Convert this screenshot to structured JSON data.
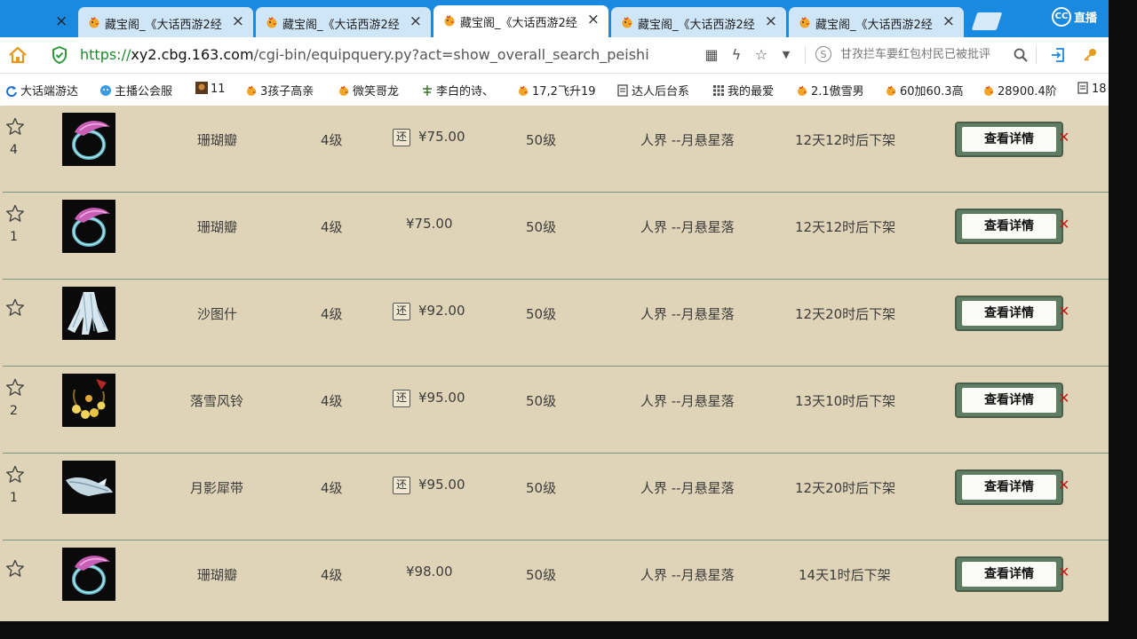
{
  "tabs": [
    {
      "title": "藏宝阁_《大话西游2经",
      "active": false
    },
    {
      "title": "藏宝阁_《大话西游2经",
      "active": false
    },
    {
      "title": "藏宝阁_《大话西游2经",
      "active": true
    },
    {
      "title": "藏宝阁_《大话西游2经",
      "active": false
    },
    {
      "title": "藏宝阁_《大话西游2经",
      "active": false
    }
  ],
  "overlay_logo": {
    "text": "直播",
    "mark": "CC"
  },
  "address": {
    "scheme": "https://",
    "host": "xy2.cbg.163.com",
    "path": "/cgi-bin/equipquery.py?act=show_overall_search_peishi"
  },
  "search": {
    "placeholder": "甘孜拦车要红包村民已被批评"
  },
  "bookmarks": [
    {
      "label": "大话端游达",
      "icon": "sync-icon"
    },
    {
      "label": "主播公会服",
      "icon": "cloud-icon"
    },
    {
      "label": "11",
      "icon": "game-avatar-icon"
    },
    {
      "label": "3孩子高亲",
      "icon": "chick-icon"
    },
    {
      "label": "微笑哥龙",
      "icon": "chick-icon"
    },
    {
      "label": "李白的诗、",
      "icon": "tea-icon"
    },
    {
      "label": "17,2飞升19",
      "icon": "chick-icon"
    },
    {
      "label": "达人后台系",
      "icon": "page-icon"
    },
    {
      "label": "我的最爱",
      "icon": "grid-icon"
    },
    {
      "label": "2.1傲雪男",
      "icon": "chick-icon"
    },
    {
      "label": "60加60.3高",
      "icon": "chick-icon"
    },
    {
      "label": "28900.4阶",
      "icon": "chick-icon"
    },
    {
      "label": "18",
      "icon": "page-icon"
    }
  ],
  "listing": {
    "detail_label": "查看详情",
    "returnable_badge": "还",
    "rows": [
      {
        "name": "珊瑚瓣",
        "level": "4级",
        "returnable": true,
        "price": "¥75.00",
        "req_level": "50级",
        "server": "人界 --月悬星落",
        "time_left": "12天12时后下架",
        "fav_count": "4",
        "img": "coral"
      },
      {
        "name": "珊瑚瓣",
        "level": "4级",
        "returnable": false,
        "price": "¥75.00",
        "req_level": "50级",
        "server": "人界 --月悬星落",
        "time_left": "12天12时后下架",
        "fav_count": "1",
        "img": "coral"
      },
      {
        "name": "沙图什",
        "level": "4级",
        "returnable": true,
        "price": "¥92.00",
        "req_level": "50级",
        "server": "人界 --月悬星落",
        "time_left": "12天20时后下架",
        "fav_count": "",
        "img": "shawl"
      },
      {
        "name": "落雪风铃",
        "level": "4级",
        "returnable": true,
        "price": "¥95.00",
        "req_level": "50级",
        "server": "人界 --月悬星落",
        "time_left": "13天10时后下架",
        "fav_count": "2",
        "img": "bells"
      },
      {
        "name": "月影犀带",
        "level": "4级",
        "returnable": true,
        "price": "¥95.00",
        "req_level": "50级",
        "server": "人界 --月悬星落",
        "time_left": "12天20时后下架",
        "fav_count": "1",
        "img": "sash"
      },
      {
        "name": "珊瑚瓣",
        "level": "4级",
        "returnable": false,
        "price": "¥98.00",
        "req_level": "50级",
        "server": "人界 --月悬星落",
        "time_left": "14天1时后下架",
        "fav_count": "",
        "img": "coral"
      }
    ]
  },
  "colors": {
    "tabbar": "#1a8ae0",
    "listing_bg": "#e0d4b8",
    "row_divider": "#7a947d",
    "button_frame": "#5e7e63",
    "url_scheme": "#1e8a2b"
  }
}
